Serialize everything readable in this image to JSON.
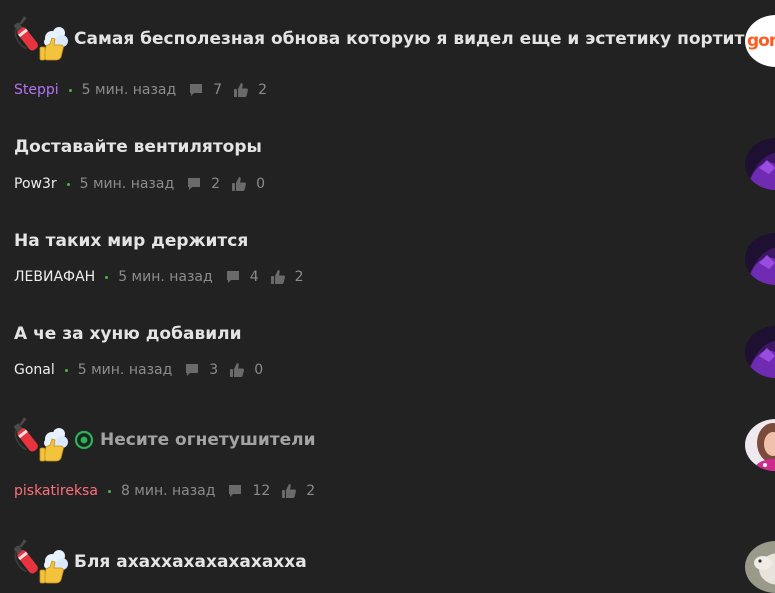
{
  "comments": [
    {
      "title": "Самая бесполезная обнова которую я видел еще и эстетику портит",
      "author": "Steppi",
      "author_color": "#b473f2",
      "time": "5 мин. назад",
      "comments_count": "7",
      "likes_count": "2",
      "emoji": "fire-extinguisher-icon",
      "avatar_text": "gom"
    },
    {
      "title": "Доставайте вентиляторы",
      "author": "Pow3r",
      "author_color": "#ededed",
      "time": "5 мин. назад",
      "comments_count": "2",
      "likes_count": "0"
    },
    {
      "title": "На таких мир держится",
      "author": "ЛЕВИАФАН",
      "author_color": "#ededed",
      "time": "5 мин. назад",
      "comments_count": "4",
      "likes_count": "2"
    },
    {
      "title": "А че за хуню добавили",
      "author": "Gonal",
      "author_color": "#ededed",
      "time": "5 мин. назад",
      "comments_count": "3",
      "likes_count": "0"
    },
    {
      "title": "Несите огнетушители",
      "author": "piskatireksa",
      "author_color": "#ff6f7d",
      "time": "8 мин. назад",
      "comments_count": "12",
      "likes_count": "2",
      "emoji": "fire-extinguisher-icon",
      "badge": "green-target-icon"
    },
    {
      "title": "Бля ахаххахахахахахха",
      "emoji": "fire-extinguisher-icon"
    }
  ],
  "colors": {
    "background": "#222222",
    "title": "#e4e4e4",
    "muted_title": "#a3a3a3",
    "meta": "#8c8c8c",
    "dot": "#4bb34b",
    "icon": "#6a6a6a"
  }
}
